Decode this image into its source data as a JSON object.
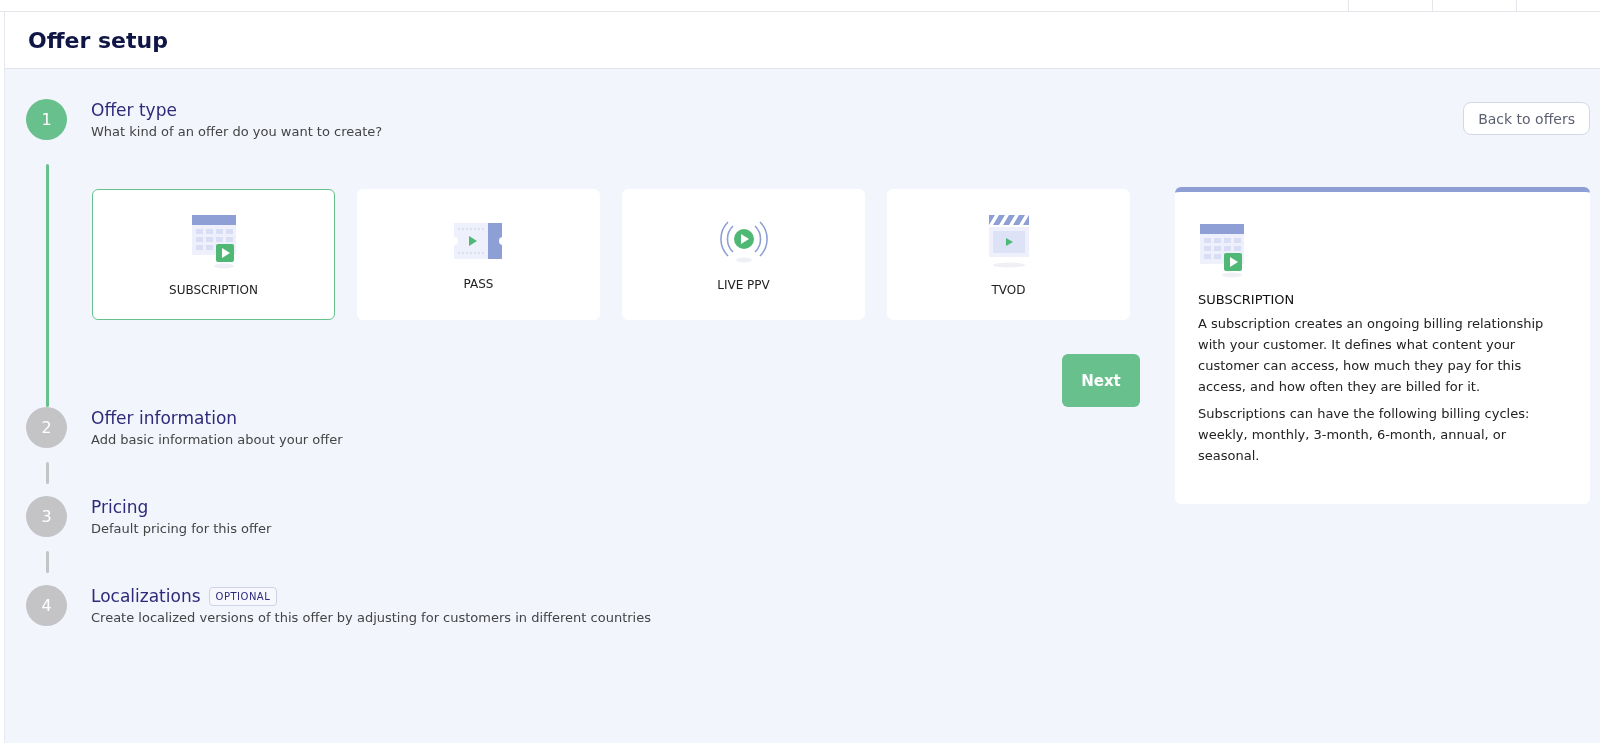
{
  "header": {
    "title": "Offer setup"
  },
  "back_button": "Back to offers",
  "steps": [
    {
      "number": "1",
      "title": "Offer type",
      "subtitle": "What kind of an offer do you want to create?",
      "active": true,
      "options": [
        {
          "label": "SUBSCRIPTION",
          "selected": true
        },
        {
          "label": "PASS",
          "selected": false
        },
        {
          "label": "LIVE PPV",
          "selected": false
        },
        {
          "label": "TVOD",
          "selected": false
        }
      ],
      "next_button": "Next"
    },
    {
      "number": "2",
      "title": "Offer information",
      "subtitle": "Add basic information about your offer",
      "active": false
    },
    {
      "number": "3",
      "title": "Pricing",
      "subtitle": "Default pricing for this offer",
      "active": false
    },
    {
      "number": "4",
      "title": "Localizations",
      "badge": "OPTIONAL",
      "subtitle": "Create localized versions of this offer by adjusting for customers in different countries",
      "active": false
    }
  ],
  "info_panel": {
    "title": "SUBSCRIPTION",
    "paragraphs": [
      "A subscription creates an ongoing billing relationship with your customer. It defines what content your customer can access, how much they pay for this access, and how often they are billed for it.",
      "Subscriptions can have the following billing cycles: weekly, monthly, 3-month, 6-month, annual, or seasonal."
    ]
  }
}
